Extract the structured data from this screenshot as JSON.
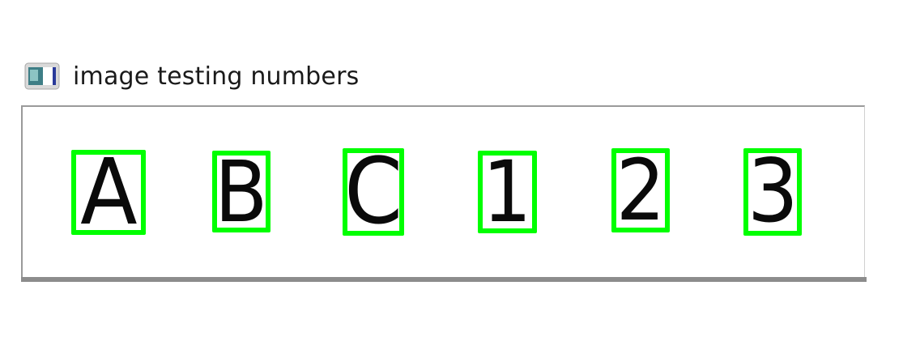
{
  "window": {
    "title": "image testing numbers",
    "icon": "window-app-icon"
  },
  "canvas": {
    "background": "#ffffff",
    "box_color": "#00ff00",
    "glyphs": [
      "A",
      "B",
      "C",
      "1",
      "2",
      "3"
    ]
  }
}
